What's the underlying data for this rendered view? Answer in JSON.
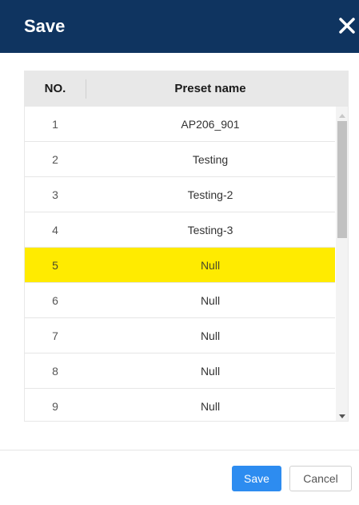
{
  "dialog": {
    "title": "Save",
    "close_icon": "close-icon"
  },
  "table": {
    "headers": {
      "no": "NO.",
      "name": "Preset name"
    },
    "selected_index": 4,
    "rows": [
      {
        "no": "1",
        "name": "AP206_901"
      },
      {
        "no": "2",
        "name": "Testing"
      },
      {
        "no": "3",
        "name": "Testing-2"
      },
      {
        "no": "4",
        "name": "Testing-3"
      },
      {
        "no": "5",
        "name": "Null"
      },
      {
        "no": "6",
        "name": "Null"
      },
      {
        "no": "7",
        "name": "Null"
      },
      {
        "no": "8",
        "name": "Null"
      },
      {
        "no": "9",
        "name": "Null"
      }
    ]
  },
  "buttons": {
    "save": "Save",
    "cancel": "Cancel"
  },
  "colors": {
    "header_bg": "#0f3460",
    "selected_row": "#ffeb00",
    "primary": "#2d8cf0"
  }
}
